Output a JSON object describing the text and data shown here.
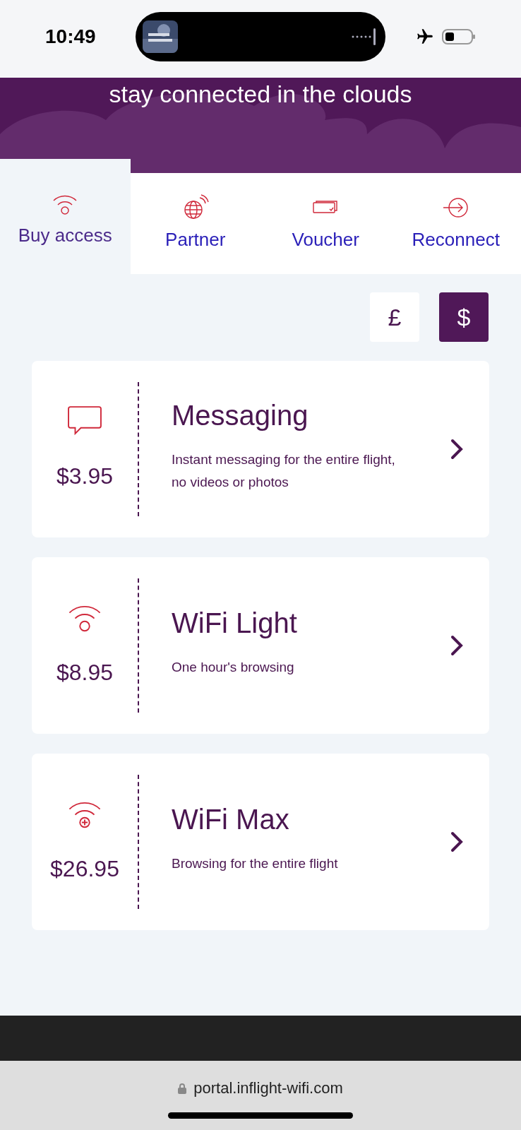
{
  "status_bar": {
    "time": "10:49"
  },
  "banner": {
    "title": "stay connected in the clouds"
  },
  "tabs": [
    {
      "label": "Buy access",
      "kind": "wifi",
      "selected": true
    },
    {
      "label": "Partner",
      "kind": "globe",
      "selected": false
    },
    {
      "label": "Voucher",
      "kind": "voucher",
      "selected": false
    },
    {
      "label": "Reconnect",
      "kind": "enter",
      "selected": false
    }
  ],
  "currencies": [
    {
      "label": "£",
      "selected": false
    },
    {
      "label": "$",
      "selected": true
    }
  ],
  "plans": [
    {
      "kind": "message",
      "price": "$3.95",
      "name": "Messaging",
      "description": "Instant messaging for the entire flight, no videos or photos"
    },
    {
      "kind": "wifi",
      "price": "$8.95",
      "name": "WiFi Light",
      "description": "One hour's browsing"
    },
    {
      "kind": "wifi-plus",
      "price": "$26.95",
      "name": "WiFi Max",
      "description": "Browsing for the entire flight"
    }
  ],
  "browser": {
    "url": "portal.inflight-wifi.com"
  }
}
